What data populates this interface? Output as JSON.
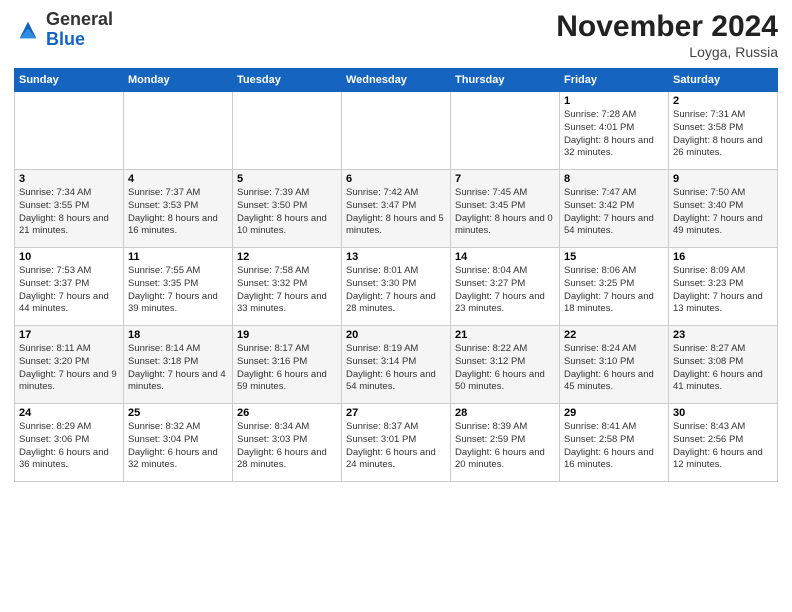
{
  "logo": {
    "text_general": "General",
    "text_blue": "Blue"
  },
  "header": {
    "month": "November 2024",
    "location": "Loyga, Russia"
  },
  "days_of_week": [
    "Sunday",
    "Monday",
    "Tuesday",
    "Wednesday",
    "Thursday",
    "Friday",
    "Saturday"
  ],
  "weeks": [
    [
      {
        "day": "",
        "info": ""
      },
      {
        "day": "",
        "info": ""
      },
      {
        "day": "",
        "info": ""
      },
      {
        "day": "",
        "info": ""
      },
      {
        "day": "",
        "info": ""
      },
      {
        "day": "1",
        "info": "Sunrise: 7:28 AM\nSunset: 4:01 PM\nDaylight: 8 hours and 32 minutes."
      },
      {
        "day": "2",
        "info": "Sunrise: 7:31 AM\nSunset: 3:58 PM\nDaylight: 8 hours and 26 minutes."
      }
    ],
    [
      {
        "day": "3",
        "info": "Sunrise: 7:34 AM\nSunset: 3:55 PM\nDaylight: 8 hours and 21 minutes."
      },
      {
        "day": "4",
        "info": "Sunrise: 7:37 AM\nSunset: 3:53 PM\nDaylight: 8 hours and 16 minutes."
      },
      {
        "day": "5",
        "info": "Sunrise: 7:39 AM\nSunset: 3:50 PM\nDaylight: 8 hours and 10 minutes."
      },
      {
        "day": "6",
        "info": "Sunrise: 7:42 AM\nSunset: 3:47 PM\nDaylight: 8 hours and 5 minutes."
      },
      {
        "day": "7",
        "info": "Sunrise: 7:45 AM\nSunset: 3:45 PM\nDaylight: 8 hours and 0 minutes."
      },
      {
        "day": "8",
        "info": "Sunrise: 7:47 AM\nSunset: 3:42 PM\nDaylight: 7 hours and 54 minutes."
      },
      {
        "day": "9",
        "info": "Sunrise: 7:50 AM\nSunset: 3:40 PM\nDaylight: 7 hours and 49 minutes."
      }
    ],
    [
      {
        "day": "10",
        "info": "Sunrise: 7:53 AM\nSunset: 3:37 PM\nDaylight: 7 hours and 44 minutes."
      },
      {
        "day": "11",
        "info": "Sunrise: 7:55 AM\nSunset: 3:35 PM\nDaylight: 7 hours and 39 minutes."
      },
      {
        "day": "12",
        "info": "Sunrise: 7:58 AM\nSunset: 3:32 PM\nDaylight: 7 hours and 33 minutes."
      },
      {
        "day": "13",
        "info": "Sunrise: 8:01 AM\nSunset: 3:30 PM\nDaylight: 7 hours and 28 minutes."
      },
      {
        "day": "14",
        "info": "Sunrise: 8:04 AM\nSunset: 3:27 PM\nDaylight: 7 hours and 23 minutes."
      },
      {
        "day": "15",
        "info": "Sunrise: 8:06 AM\nSunset: 3:25 PM\nDaylight: 7 hours and 18 minutes."
      },
      {
        "day": "16",
        "info": "Sunrise: 8:09 AM\nSunset: 3:23 PM\nDaylight: 7 hours and 13 minutes."
      }
    ],
    [
      {
        "day": "17",
        "info": "Sunrise: 8:11 AM\nSunset: 3:20 PM\nDaylight: 7 hours and 9 minutes."
      },
      {
        "day": "18",
        "info": "Sunrise: 8:14 AM\nSunset: 3:18 PM\nDaylight: 7 hours and 4 minutes."
      },
      {
        "day": "19",
        "info": "Sunrise: 8:17 AM\nSunset: 3:16 PM\nDaylight: 6 hours and 59 minutes."
      },
      {
        "day": "20",
        "info": "Sunrise: 8:19 AM\nSunset: 3:14 PM\nDaylight: 6 hours and 54 minutes."
      },
      {
        "day": "21",
        "info": "Sunrise: 8:22 AM\nSunset: 3:12 PM\nDaylight: 6 hours and 50 minutes."
      },
      {
        "day": "22",
        "info": "Sunrise: 8:24 AM\nSunset: 3:10 PM\nDaylight: 6 hours and 45 minutes."
      },
      {
        "day": "23",
        "info": "Sunrise: 8:27 AM\nSunset: 3:08 PM\nDaylight: 6 hours and 41 minutes."
      }
    ],
    [
      {
        "day": "24",
        "info": "Sunrise: 8:29 AM\nSunset: 3:06 PM\nDaylight: 6 hours and 36 minutes."
      },
      {
        "day": "25",
        "info": "Sunrise: 8:32 AM\nSunset: 3:04 PM\nDaylight: 6 hours and 32 minutes."
      },
      {
        "day": "26",
        "info": "Sunrise: 8:34 AM\nSunset: 3:03 PM\nDaylight: 6 hours and 28 minutes."
      },
      {
        "day": "27",
        "info": "Sunrise: 8:37 AM\nSunset: 3:01 PM\nDaylight: 6 hours and 24 minutes."
      },
      {
        "day": "28",
        "info": "Sunrise: 8:39 AM\nSunset: 2:59 PM\nDaylight: 6 hours and 20 minutes."
      },
      {
        "day": "29",
        "info": "Sunrise: 8:41 AM\nSunset: 2:58 PM\nDaylight: 6 hours and 16 minutes."
      },
      {
        "day": "30",
        "info": "Sunrise: 8:43 AM\nSunset: 2:56 PM\nDaylight: 6 hours and 12 minutes."
      }
    ]
  ]
}
